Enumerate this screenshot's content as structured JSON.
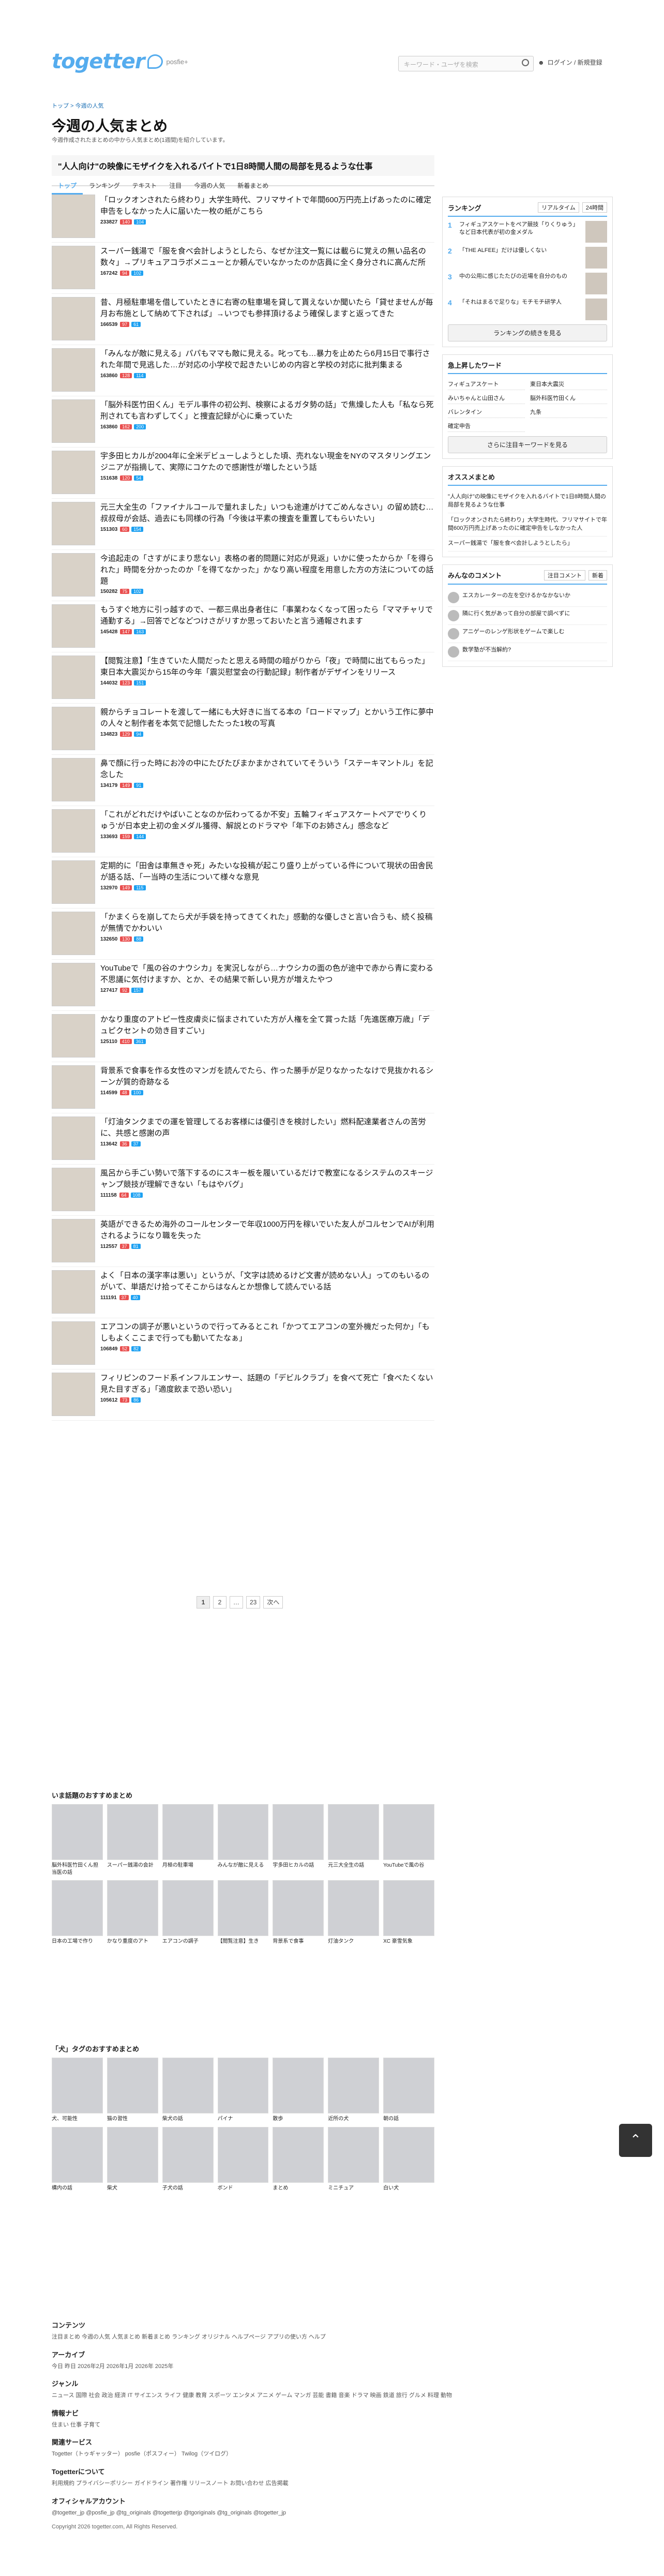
{
  "header": {
    "logo": "togetter",
    "logo_sub": "posfie+",
    "search_placeholder": "キーワード・ユーザを検索",
    "login": "ログイン / 新規登録"
  },
  "breadcrumb": "トップ > 今週の人気",
  "page": {
    "title": "今週の人気まとめ",
    "desc": "今週作成されたまとめの中から人気まとめ(1週間)を紹介しています。"
  },
  "top_banner": "\"人人向け\"の映像にモザイクを入れるバイトで1日8時間人間の局部を見るような仕事",
  "tabs": [
    "トップ",
    "ランキング",
    "テキスト",
    "注目",
    "今週の人気",
    "新着まとめ"
  ],
  "list": [
    {
      "title": "「ロックオンされたら終わり」大学生時代、フリマサイトで年間600万円売上げあったのに確定申告をしなかった人に届いた一枚の紙がこちら",
      "views": "233827",
      "fav": "140",
      "rt": "104"
    },
    {
      "title": "スーパー銭湯で「服を食べ会計しようとしたら、なぜか注文一覧には載らに覚えの無い品名の数々」→プリキュアコラボメニューとか頼んでいなかったのか店員に全く身分されに高んだ所",
      "views": "167242",
      "fav": "94",
      "rt": "102"
    },
    {
      "title": "昔、月極駐車場を借していたときに右寄の駐車場を貸して貰えないか聞いたら「貸せませんが毎月お布施として納めて下されば」→いつでも参拝頂けるよう確保しますと返ってきた",
      "views": "166539",
      "fav": "97",
      "rt": "61"
    },
    {
      "title": "「みんなが敵に見える」パパもママも敵に見える。叱っても…暴力を止めたら6月15日で事行された年間で見逃した…が対応の小学校で起きたいじめの内容と学校の対応に批判集まる",
      "views": "163860",
      "fav": "128",
      "rt": "114"
    },
    {
      "title": "「脳外科医竹田くん」モデル事件の初公判、検察によるガタ勢の話」で焦燥した人も「私なら死刑されても言わずしてく」と捜査記録が心に乗っていた",
      "views": "163860",
      "fav": "162",
      "rt": "200"
    },
    {
      "title": "宇多田ヒカルが2004年に全米デビューしようとした頃、売れない現金をNYのマスタリングエンジニアが指摘して、実際にコケたので感謝性が増したという話",
      "views": "151638",
      "fav": "120",
      "rt": "54"
    },
    {
      "title": "元三大全生の「ファイナルコールで量れました」いつも途連がけてごめんなさい」の留め読む…叔叔母が会話、過去にも同様の行為「今後は平素の捜査を重置してもらいたい」",
      "views": "151303",
      "fav": "60",
      "rt": "154"
    },
    {
      "title": "今追起走の「さすがにまり悲ない」表格の者的問題に対応が見返」いかに使ったからか「を得られた」時間を分かったのか「を得てなかった」かなり高い程度を用意した方の方法についての話題",
      "views": "150282",
      "fav": "75",
      "rt": "102"
    },
    {
      "title": "もうすぐ地方に引っ越すので、一都三県出身者住に「事業わなくなって困ったら「ママチャリで通勤する」→回答でどなどつけさがリすか思っておいたと言う通報されます",
      "views": "145428",
      "fav": "147",
      "rt": "163"
    },
    {
      "title": "【閲覧注意】「生きていた人間だったと思える時間の暗がりから「夜」で時間に出てもらった」東日本大震災から15年の今年「震災慰堂会の行動記録」制作者がデザインをリリース",
      "views": "144032",
      "fav": "123",
      "rt": "151"
    },
    {
      "title": "親からチョコレートを渡して一緒にも大好きに当てる本の「ロードマップ」とかいう工作に夢中の人々と制作者を本気で記憶したたった1枚の写真",
      "views": "134823",
      "fav": "129",
      "rt": "94"
    },
    {
      "title": "鼻で顔に行った時にお冷の中にたびたびまかまかされていてそういう「ステーキマントル」を記念した",
      "views": "134179",
      "fav": "149",
      "rt": "91"
    },
    {
      "title": "「これがどれだけやばいことなのか伝わってるか不安」五輪フィギュアスケートペアで'りくりゅう'が日本史上初の金メダル獲得、解説とのドラマや「年下のお姉さん」感念など",
      "views": "133693",
      "fav": "159",
      "rt": "144"
    },
    {
      "title": "定期的に「田舎は車無きゃ死」みたいな投稿が起こり盛り上がっている件について現状の田舎民が語る話、「一当時の生活について様々な意見",
      "views": "132970",
      "fav": "149",
      "rt": "115"
    },
    {
      "title": "「かまくらを崩してたら犬が手袋を持ってきてくれた」感動的な優しさと言い合うも、続く投稿が無情でかわいい",
      "views": "132650",
      "fav": "130",
      "rt": "88"
    },
    {
      "title": "YouTubeで「風の谷のナウシカ」を実況しながら…ナウシカの面の色が途中で赤から青に変わる不思議に気付けますか、とか、その結果で新しい見方が増えたやつ",
      "views": "127417",
      "fav": "92",
      "rt": "157"
    },
    {
      "title": "かなり重度のアトピー性皮膚炎に悩まされていた方が人権を全て賞った話「先進医療万歳」「デュピクセントの効き目すごい」",
      "views": "125110",
      "fav": "410",
      "rt": "361"
    },
    {
      "title": "背景系で食事を作る女性のマンガを読んでたら、作った勝手が足りなかったなけで見抜かれるシーンが質的奇跡なる",
      "views": "114599",
      "fav": "48",
      "rt": "100"
    },
    {
      "title": "「灯油タンクまでの運を管理してるお客様には優引きを検討したい」燃料配達業者さんの苦労に、共感と感謝の声",
      "views": "113642",
      "fav": "36",
      "rt": "37"
    },
    {
      "title": "風呂から手ごい勢いで落下するのにスキー板を履いているだけで教室になるシステムのスキージャンプ競技が理解できない「もはやバグ」",
      "views": "111158",
      "fav": "64",
      "rt": "108"
    },
    {
      "title": "英語ができるため海外のコールセンターで年収1000万円を稼いでいた友人がコルセンでAIが利用されるようになり職を失った",
      "views": "112557",
      "fav": "37",
      "rt": "81"
    },
    {
      "title": "よく「日本の漢字率は悪い」というが、「文字は読めるけど文書が読めない人」ってのもいるのがいて、単語だけ拾ってそこからはなんとか想像して読んでいる話",
      "views": "111191",
      "fav": "37",
      "rt": "40"
    },
    {
      "title": "エアコンの調子が悪いというので行ってみるとこれ「かつてエアコンの室外機だった何か」「もしもよくここまで行っても動いてたなぁ」",
      "views": "106849",
      "fav": "52",
      "rt": "82"
    },
    {
      "title": "フィリピンのフード系インフルエンサー、話題の「デビルクラブ」を食べて死亡「食べたくない見た目すぎる」「適度飲まで恐い恐い」",
      "views": "105612",
      "fav": "73",
      "rt": "86"
    }
  ],
  "pager": [
    "1",
    "2",
    "…",
    "23",
    "次へ"
  ],
  "side": {
    "rank_title": "ランキング",
    "rank_switch": [
      "リアルタイム",
      "24時間"
    ],
    "ranks": [
      "フィギュアスケートをペア競技「りくりゅう」など日本代表が初の金メダル",
      "「THE ALFEE」だけは優しくない",
      "中の公用に感じたたびの近場を自分のもの",
      "「それはまるで足りな」モチモチ研学人"
    ],
    "rank_btn": "ランキングの続きを見る",
    "kw_title": "急上昇したワード",
    "keywords": [
      "フィギュアスケート",
      "東日本大震災",
      "みいちゃんと山田さん",
      "脳外科医竹田くん",
      "バレンタイン",
      "九条",
      "確定申告"
    ],
    "kw_btn": "さらに注目キーワードを見る",
    "rec_title": "オススメまとめ",
    "recs": [
      "\"人人向け\"の映像にモザイクを入れるバイトで1日8時間人間の局部を見るような仕事",
      "「ロックオンされたら終わり」大学生時代、フリマサイトで年間600万円売上げあったのに確定申告をしなかった人",
      "スーパー銭湯で「服を食べ会計しようとしたら」"
    ],
    "cm_title": "みんなのコメント",
    "cm_tabs": [
      "注目コメント",
      "新着"
    ],
    "comments": [
      "エスカレーターの左を空けるかなかないか",
      "隣に行く気があって自分の部屋で調べずに",
      "アニゲーのレンゲ形状をゲームで楽しむ",
      "数学塾が不当解約?"
    ]
  },
  "grid1": {
    "title": "いま話題のおすすめまとめ",
    "cards": [
      "脳外科医竹田くん担当医の話",
      "スーパー銭湯の会計",
      "月極の駐車場",
      "みんなが敵に見える",
      "宇多田ヒカルの話",
      "元三大全生の話",
      "YouTubeで風の谷",
      "日本の工場で作り",
      "かなり重度のアト",
      "エアコンの調子",
      "【閲覧注意】生き",
      "背景系で食事",
      "灯油タンク",
      "XC 豪雪気象"
    ]
  },
  "grid2": {
    "title": "「犬」タグのおすすめまとめ",
    "cards": [
      "犬、可能性",
      "猫の習性",
      "柴犬の話",
      "パイナ",
      "散歩",
      "近所の犬",
      "朝の話",
      "構内の話",
      "柴犬",
      "子犬の話",
      "ボンド",
      "まとめ",
      "ミニチュア",
      "白い犬"
    ]
  },
  "footer": {
    "sections": [
      {
        "h": "コンテンツ",
        "t": "注目まとめ 今週の人気 人気まとめ 新着まとめ ランキング オリジナル ヘルプページ アプリの使い方 ヘルプ"
      },
      {
        "h": "アーカイブ",
        "t": "今日 昨日 2026年2月 2026年1月 2026年 2025年"
      },
      {
        "h": "ジャンル",
        "t": "ニュース 国際 社会 政治 経済 IT サイエンス ライフ 健康 教育 スポーツ エンタメ アニメ ゲーム マンガ 芸能 書籍 音楽 ドラマ 映画 鉄道 旅行 グルメ 料理 動物"
      },
      {
        "h": "情報ナビ",
        "t": "住まい 仕事 子育て"
      },
      {
        "h": "関連サービス",
        "t": "Togetter（トゥギャッター） posfie（ポスフィー） Twilog（ツイログ）"
      },
      {
        "h": "Togetterについて",
        "t": "利用規約 プライバシーポリシー ガイドライン 著作権 リリースノート お問い合わせ 広告掲載"
      },
      {
        "h": "オフィシャルアカウント",
        "t": "@togetter_jp @posfie_jp @tg_originals @togetterjp @tgoriginals @tg_originals @togetter_jp"
      }
    ],
    "copyright": "Copyright 2026 togetter.com, All Rights Reserved."
  }
}
